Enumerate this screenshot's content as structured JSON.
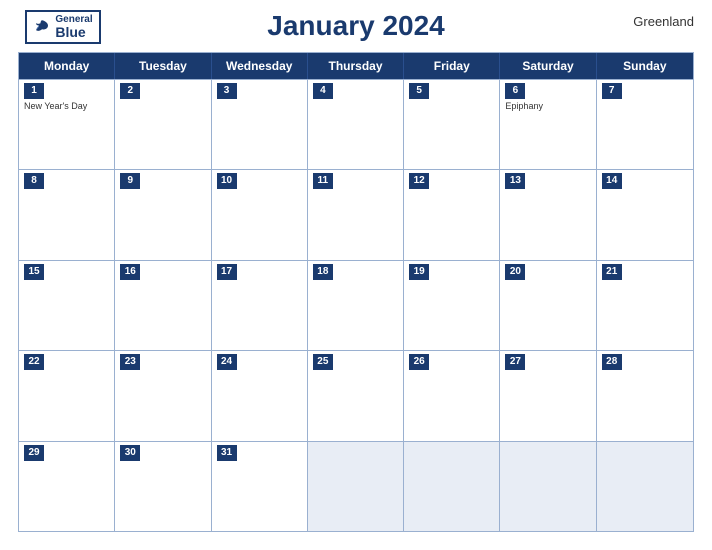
{
  "header": {
    "logo": {
      "general": "General",
      "blue": "Blue",
      "bird_symbol": "▲"
    },
    "title": "January 2024",
    "region": "Greenland"
  },
  "dayHeaders": [
    "Monday",
    "Tuesday",
    "Wednesday",
    "Thursday",
    "Friday",
    "Saturday",
    "Sunday"
  ],
  "weeks": [
    [
      {
        "day": 1,
        "holiday": "New Year's Day"
      },
      {
        "day": 2,
        "holiday": ""
      },
      {
        "day": 3,
        "holiday": ""
      },
      {
        "day": 4,
        "holiday": ""
      },
      {
        "day": 5,
        "holiday": ""
      },
      {
        "day": 6,
        "holiday": "Epiphany"
      },
      {
        "day": 7,
        "holiday": ""
      }
    ],
    [
      {
        "day": 8,
        "holiday": ""
      },
      {
        "day": 9,
        "holiday": ""
      },
      {
        "day": 10,
        "holiday": ""
      },
      {
        "day": 11,
        "holiday": ""
      },
      {
        "day": 12,
        "holiday": ""
      },
      {
        "day": 13,
        "holiday": ""
      },
      {
        "day": 14,
        "holiday": ""
      }
    ],
    [
      {
        "day": 15,
        "holiday": ""
      },
      {
        "day": 16,
        "holiday": ""
      },
      {
        "day": 17,
        "holiday": ""
      },
      {
        "day": 18,
        "holiday": ""
      },
      {
        "day": 19,
        "holiday": ""
      },
      {
        "day": 20,
        "holiday": ""
      },
      {
        "day": 21,
        "holiday": ""
      }
    ],
    [
      {
        "day": 22,
        "holiday": ""
      },
      {
        "day": 23,
        "holiday": ""
      },
      {
        "day": 24,
        "holiday": ""
      },
      {
        "day": 25,
        "holiday": ""
      },
      {
        "day": 26,
        "holiday": ""
      },
      {
        "day": 27,
        "holiday": ""
      },
      {
        "day": 28,
        "holiday": ""
      }
    ],
    [
      {
        "day": 29,
        "holiday": ""
      },
      {
        "day": 30,
        "holiday": ""
      },
      {
        "day": 31,
        "holiday": ""
      },
      {
        "day": null,
        "holiday": ""
      },
      {
        "day": null,
        "holiday": ""
      },
      {
        "day": null,
        "holiday": ""
      },
      {
        "day": null,
        "holiday": ""
      }
    ]
  ]
}
